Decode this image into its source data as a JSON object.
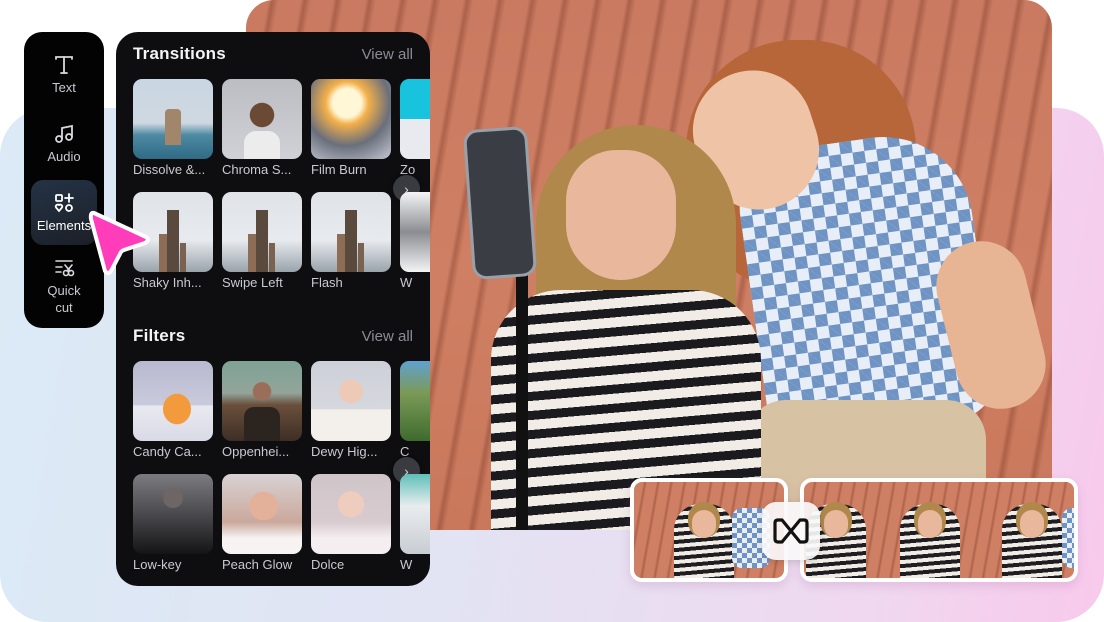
{
  "toolbar": {
    "items": [
      {
        "label": "Text",
        "icon": "text-icon",
        "active": false
      },
      {
        "label": "Audio",
        "icon": "music-note-icon",
        "active": false
      },
      {
        "label": "Elements",
        "icon": "elements-icon",
        "active": true
      },
      {
        "label": "Quick\ncut",
        "line1": "Quick",
        "line2": "cut",
        "icon": "quick-cut-icon",
        "active": false
      }
    ]
  },
  "panel": {
    "transitions": {
      "title": "Transitions",
      "view_all": "View all",
      "row1": [
        "Dissolve &...",
        "Chroma S...",
        "Film Burn",
        "Zo"
      ],
      "row2": [
        "Shaky Inh...",
        "Swipe Left",
        "Flash",
        "W"
      ]
    },
    "filters": {
      "title": "Filters",
      "view_all": "View all",
      "row1": [
        "Candy Ca...",
        "Oppenhei...",
        "Dewy Hig...",
        "C"
      ],
      "row2": [
        "Low-key",
        "Peach Glow",
        "Dolce",
        "W"
      ]
    },
    "next_arrow": "›"
  },
  "timeline": {
    "transition_icon": "infinity-transition-icon"
  },
  "colors": {
    "cursor_pink": "#ff3dbb",
    "panel_bg": "#0e0e11",
    "toolbar_bg": "#030304",
    "active_tool_bg": "#243346",
    "bg_blue": "#dbeaf6",
    "bg_pink": "#f8c9ec"
  }
}
